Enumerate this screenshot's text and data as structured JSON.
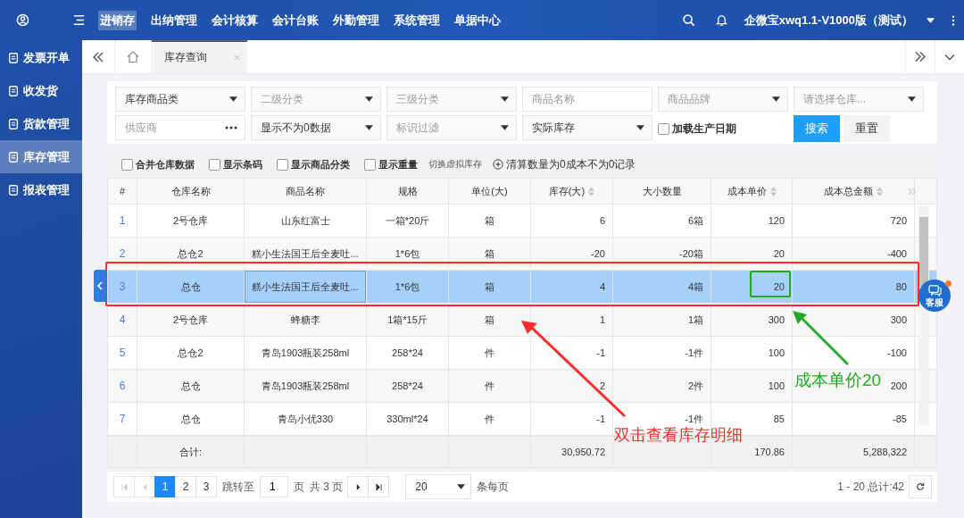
{
  "top_nav": {
    "menu": [
      {
        "label": "进销存",
        "selected": true
      },
      {
        "label": "出纳管理",
        "selected": false
      },
      {
        "label": "会计核算",
        "selected": false
      },
      {
        "label": "会计台账",
        "selected": false
      },
      {
        "label": "外勤管理",
        "selected": false
      },
      {
        "label": "系统管理",
        "selected": false
      },
      {
        "label": "单据中心",
        "selected": false
      }
    ],
    "account": "企微宝xwq1.1-V1000版（测试）"
  },
  "sidebar": {
    "items": [
      {
        "label": "发票开单",
        "selected": false
      },
      {
        "label": "收发货",
        "selected": false
      },
      {
        "label": "货款管理",
        "selected": false
      },
      {
        "label": "库存管理",
        "selected": true
      },
      {
        "label": "报表管理",
        "selected": false
      }
    ]
  },
  "tabs": [
    {
      "label": "库存查询",
      "selected": true
    }
  ],
  "filters": [
    {
      "kind": "select",
      "value": "库存商品类"
    },
    {
      "kind": "select",
      "placeholder": "二级分类"
    },
    {
      "kind": "select",
      "placeholder": "三级分类"
    },
    {
      "kind": "input",
      "placeholder": "商品名称"
    },
    {
      "kind": "select",
      "placeholder": "商品品牌"
    },
    {
      "kind": "select",
      "placeholder": "请选择仓库..."
    },
    {
      "kind": "picker",
      "placeholder": "供应商"
    },
    {
      "kind": "select",
      "value": "显示不为0数据"
    },
    {
      "kind": "select",
      "placeholder": "标识过滤"
    },
    {
      "kind": "select",
      "value": "实际库存"
    },
    {
      "kind": "checkbox",
      "label": "加载生产日期",
      "checked": false
    },
    {
      "kind": "buttons",
      "buttons": [
        {
          "label": "搜索",
          "primary": true
        },
        {
          "label": "重置",
          "primary": false
        }
      ]
    }
  ],
  "options": [
    {
      "kind": "checkbox",
      "label": "合并仓库数据",
      "checked": false
    },
    {
      "kind": "checkbox",
      "label": "显示条码",
      "checked": false
    },
    {
      "kind": "checkbox",
      "label": "显示商品分类",
      "checked": false
    },
    {
      "kind": "checkbox",
      "label": "显示重量",
      "checked": false
    },
    {
      "kind": "link",
      "label": "切换虚拟库存"
    },
    {
      "kind": "add",
      "label": "清算数量为0成本不为0记录"
    }
  ],
  "table": {
    "columns": [
      {
        "label": "#",
        "sortable": false
      },
      {
        "label": "仓库名称",
        "sortable": false
      },
      {
        "label": "商品名称",
        "sortable": false
      },
      {
        "label": "规格",
        "sortable": false
      },
      {
        "label": "单位(大)",
        "sortable": false
      },
      {
        "label": "库存(大)",
        "sortable": true
      },
      {
        "label": "大小数量",
        "sortable": false
      },
      {
        "label": "成本单价",
        "sortable": true
      },
      {
        "label": "成本总金额",
        "sortable": true
      }
    ],
    "rows": [
      {
        "selected": false,
        "cells": [
          "1",
          "2号仓库",
          "山东红富士",
          "一箱*20斤",
          "箱",
          "6",
          "6箱",
          "120",
          "720"
        ]
      },
      {
        "selected": false,
        "cells": [
          "2",
          "总仓2",
          "糕小生法国王后全麦吐...",
          "1*6包",
          "箱",
          "-20",
          "-20箱",
          "20",
          "-400"
        ]
      },
      {
        "selected": true,
        "cells": [
          "3",
          "总仓",
          "糕小生法国王后全麦吐...",
          "1*6包",
          "箱",
          "4",
          "4箱",
          "20",
          "80"
        ]
      },
      {
        "selected": false,
        "cells": [
          "4",
          "2号仓库",
          "蜂糖李",
          "1箱*15斤",
          "箱",
          "1",
          "1箱",
          "300",
          "300"
        ]
      },
      {
        "selected": false,
        "cells": [
          "5",
          "总仓2",
          "青岛1903瓶装258ml",
          "258*24",
          "件",
          "-1",
          "-1件",
          "100",
          "-100"
        ]
      },
      {
        "selected": false,
        "cells": [
          "6",
          "总仓",
          "青岛1903瓶装258ml",
          "258*24",
          "件",
          "2",
          "2件",
          "100",
          "200"
        ]
      },
      {
        "selected": false,
        "cells": [
          "7",
          "总仓",
          "青岛小优330",
          "330ml*24",
          "件",
          "-1",
          "-1件",
          "85",
          "-85"
        ]
      }
    ],
    "summary": {
      "label": "合计:",
      "stock": "30,950.72",
      "unit_cost": "170.86",
      "total_cost": "5,288,322"
    }
  },
  "pagination": {
    "pages": [
      {
        "label": "1",
        "selected": true
      },
      {
        "label": "2",
        "selected": false
      },
      {
        "label": "3",
        "selected": false
      }
    ],
    "jump_label": "跳转至",
    "jump_value": "1",
    "page_unit": "页",
    "total_pages": "共 3 页",
    "page_size": "20",
    "per_page": "条每页",
    "range": "1 - 20 总计:42"
  },
  "support": {
    "label": "客服",
    "unread": true
  },
  "annotations": [
    {
      "text": "双击查看库存明细",
      "color": "#ff2a2a"
    },
    {
      "text": "成本单价20",
      "color": "#22aa22"
    }
  ]
}
